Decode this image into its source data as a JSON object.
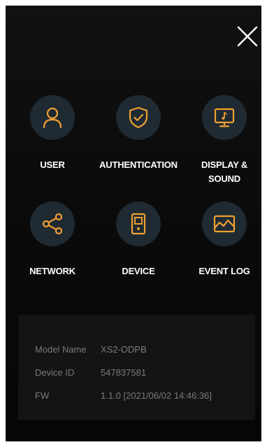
{
  "colors": {
    "accent": "#f0a030",
    "background": "#0b0b0b",
    "icon_circle": "#1f2a33",
    "info_text": "#7a7a7a"
  },
  "header": {
    "close_icon": "close-icon"
  },
  "menu": {
    "items": [
      {
        "label": "USER",
        "icon": "user-icon"
      },
      {
        "label": "AUTHENTICATION",
        "icon": "shield-check-icon"
      },
      {
        "label": "DISPLAY &\nSOUND",
        "icon": "display-sound-icon"
      },
      {
        "label": "NETWORK",
        "icon": "share-icon"
      },
      {
        "label": "DEVICE",
        "icon": "device-icon"
      },
      {
        "label": "EVENT LOG",
        "icon": "image-log-icon"
      }
    ]
  },
  "info": {
    "model_name_label": "Model Name",
    "model_name_value": "XS2-ODPB",
    "device_id_label": "Device ID",
    "device_id_value": "547837581",
    "fw_label": "FW",
    "fw_value": "1.1.0 [2021/06/02 14:46:36]"
  }
}
